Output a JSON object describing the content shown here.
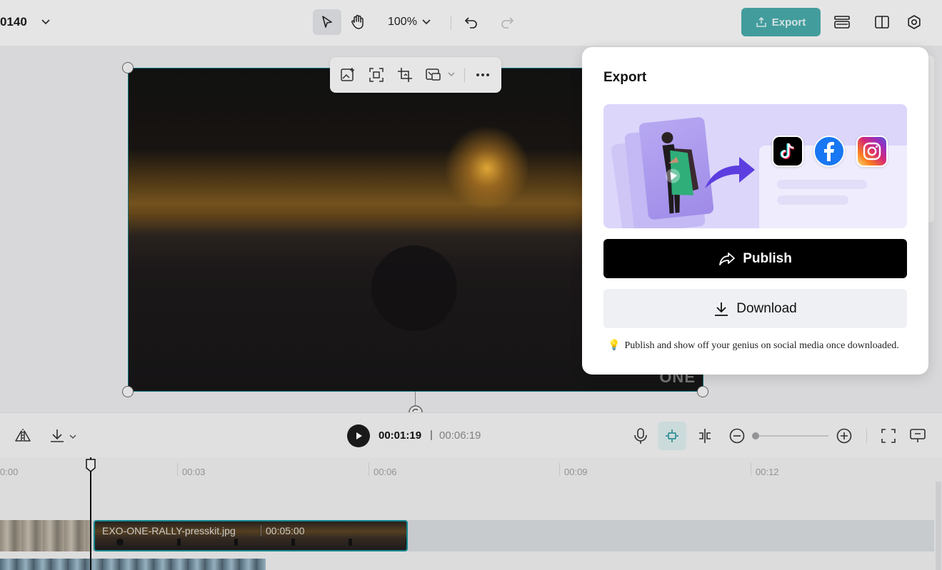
{
  "header": {
    "project_name": "0140",
    "zoom_level": "100%",
    "export_label": "Export"
  },
  "player": {
    "current_time": "00:01:19",
    "separator": "|",
    "total_time": "00:06:19"
  },
  "video": {
    "watermark": "ONE"
  },
  "timeline": {
    "ruler": [
      "0:00",
      "00:03",
      "00:06",
      "00:09",
      "00:12"
    ],
    "clip_name": "EXO-ONE-RALLY-presskit.jpg",
    "clip_duration": "00:05:00"
  },
  "export_popover": {
    "title": "Export",
    "publish_label": "Publish",
    "download_label": "Download",
    "tip_icon": "💡",
    "tip_text": "Publish and show off your genius on social media once downloaded."
  },
  "colors": {
    "accent_teal": "#0e8c8c",
    "publish_bg": "#000000",
    "banner_purple": "#dcd6fb"
  }
}
